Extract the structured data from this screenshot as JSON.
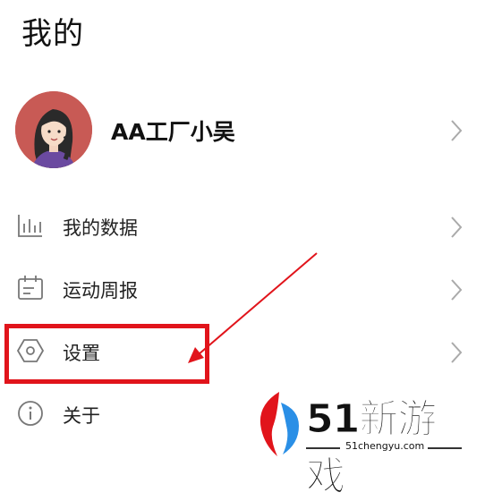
{
  "page": {
    "title": "我的"
  },
  "profile": {
    "name": "AA工厂小吴"
  },
  "menu": {
    "items": [
      {
        "label": "我的数据",
        "icon": "bar-chart-icon"
      },
      {
        "label": "运动周报",
        "icon": "calendar-icon"
      },
      {
        "label": "设置",
        "icon": "hexagon-settings-icon"
      },
      {
        "label": "关于",
        "icon": "info-icon"
      }
    ]
  },
  "annotation": {
    "color": "#e1141b"
  },
  "watermark": {
    "brand": "51新游戏",
    "domain": "51chengyu.com",
    "logo_red": "#e1141b",
    "logo_blue": "#2a8fe6"
  }
}
